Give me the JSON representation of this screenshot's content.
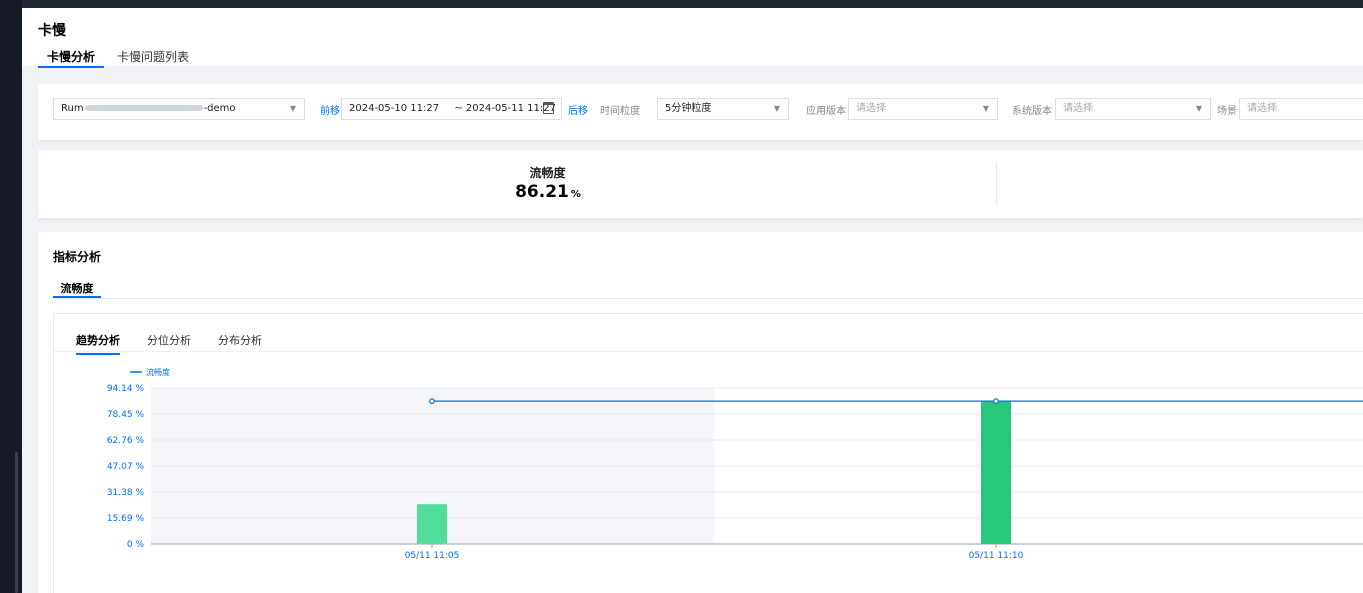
{
  "page": {
    "title": "卡慢"
  },
  "tabs": [
    {
      "label": "卡慢分析",
      "active": true
    },
    {
      "label": "卡慢问题列表",
      "active": false
    }
  ],
  "filters": {
    "app_prefix": "Rum",
    "app_suffix": "-demo",
    "prev_label": "前移",
    "next_label": "后移",
    "start": "2024-05-10 11:27",
    "end": "~ 2024-05-11 11:27",
    "granularity_label": "时间粒度",
    "granularity_value": "5分钟粒度",
    "app_version_label": "应用版本",
    "app_version_placeholder": "请选择",
    "sys_version_label": "系统版本",
    "sys_version_placeholder": "请选择",
    "scene_label": "场景",
    "scene_placeholder": "请选择"
  },
  "metric": {
    "label": "流畅度",
    "value": "86.21",
    "unit": "%"
  },
  "analysis": {
    "title": "指标分析",
    "metric_tab": "流畅度",
    "inner_tabs": [
      "趋势分析",
      "分位分析",
      "分布分析"
    ]
  },
  "colors": {
    "accent": "#006eff",
    "bar_light": "#52dd9a",
    "bar": "#29c77b",
    "shade": "#f4f6fa"
  },
  "chart_data": {
    "type": "bar",
    "legend": [
      "流畅度"
    ],
    "y_ticks": [
      "94.14 %",
      "78.45 %",
      "62.76 %",
      "47.07 %",
      "31.38 %",
      "15.69 %",
      "0 %"
    ],
    "ylim": [
      0,
      94.14
    ],
    "categories": [
      "05/11 11:05",
      "05/11 11:10"
    ],
    "bar_values": [
      24,
      86.21
    ],
    "line_values": [
      86.21,
      86.21
    ],
    "grid": true
  }
}
